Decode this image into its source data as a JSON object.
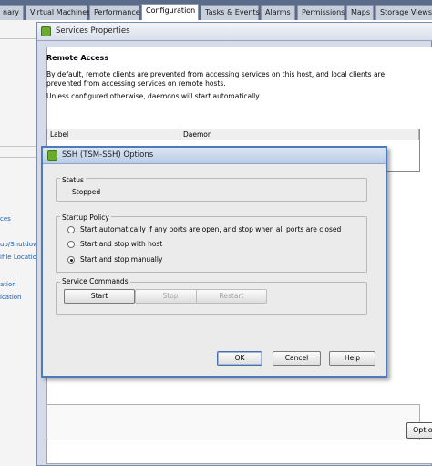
{
  "tabs": [
    {
      "label": "nary",
      "active": false
    },
    {
      "label": "Virtual Machines",
      "active": false
    },
    {
      "label": "Performance",
      "active": false
    },
    {
      "label": "Configuration",
      "active": true
    },
    {
      "label": "Tasks & Events",
      "active": false
    },
    {
      "label": "Alarms",
      "active": false
    },
    {
      "label": "Permissions",
      "active": false
    },
    {
      "label": "Maps",
      "active": false
    },
    {
      "label": "Storage Views",
      "active": false
    }
  ],
  "sidebar": {
    "links": [
      "ces",
      "up/Shutdow",
      "ifile Location",
      "ation",
      "ication"
    ]
  },
  "services_window": {
    "title": "Services Properties",
    "remote_access_heading": "Remote Access",
    "description": "By default, remote clients are prevented from accessing services on this host, and local clients are prevented from accessing services on remote hosts.",
    "note": "Unless configured otherwise, daemons will start automatically.",
    "columns": [
      "Label",
      "Daemon"
    ],
    "options_button": "Optio"
  },
  "ssh_dialog": {
    "title": "SSH (TSM-SSH) Options",
    "status": {
      "legend": "Status",
      "value": "Stopped"
    },
    "startup_policy": {
      "legend": "Startup Policy",
      "options": [
        {
          "label": "Start automatically if any ports are open, and stop when all ports are closed",
          "selected": false
        },
        {
          "label": "Start and stop with host",
          "selected": false
        },
        {
          "label": "Start and stop manually",
          "selected": true
        }
      ]
    },
    "service_commands": {
      "legend": "Service Commands",
      "start": "Start",
      "stop": "Stop",
      "restart": "Restart"
    },
    "ok": "OK",
    "cancel": "Cancel",
    "help": "Help"
  },
  "colors": {
    "tab_strip": "#5a6c8a",
    "dialog_border": "#4d7aba",
    "vmware_icon": "#6aab2c",
    "link": "#1a5cb5"
  }
}
